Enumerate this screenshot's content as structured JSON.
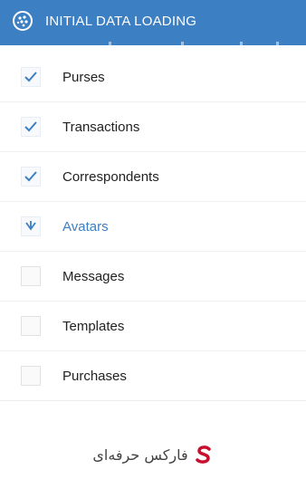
{
  "header": {
    "title": "INITIAL DATA LOADING",
    "logo_icon": "webmoney-globe-icon",
    "color": "#3d7fc3"
  },
  "items": [
    {
      "label": "Purses",
      "checked": true,
      "active": false
    },
    {
      "label": "Transactions",
      "checked": true,
      "active": false
    },
    {
      "label": "Correspondents",
      "checked": true,
      "active": false
    },
    {
      "label": "Avatars",
      "checked": true,
      "active": true
    },
    {
      "label": "Messages",
      "checked": false,
      "active": false
    },
    {
      "label": "Templates",
      "checked": false,
      "active": false
    },
    {
      "label": "Purchases",
      "checked": false,
      "active": false
    }
  ],
  "watermark": {
    "text": "فارکس حرفه‌ای",
    "icon": "s-logo-icon",
    "accent": "#c8102e"
  }
}
